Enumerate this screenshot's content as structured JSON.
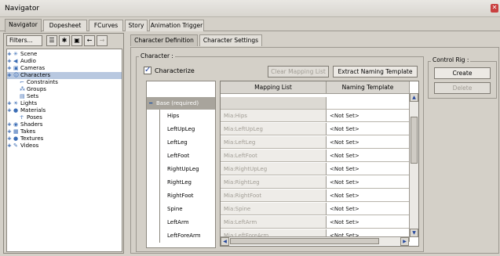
{
  "window": {
    "title": "Navigator"
  },
  "tabs": [
    {
      "label": "Navigator"
    },
    {
      "label": "Dopesheet"
    },
    {
      "label": "FCurves"
    },
    {
      "label": "Story"
    },
    {
      "label": "Animation Trigger"
    }
  ],
  "left_toolbar": {
    "filters_label": "Filters..."
  },
  "tree": [
    {
      "label": "Scene",
      "expand": "+",
      "icon": "scene-icon"
    },
    {
      "label": "Audio",
      "expand": "+",
      "icon": "audio-icon"
    },
    {
      "label": "Cameras",
      "expand": "+",
      "icon": "camera-icon"
    },
    {
      "label": "Characters",
      "expand": "+",
      "icon": "character-icon"
    },
    {
      "label": "Constraints",
      "expand": "",
      "icon": "constraint-icon"
    },
    {
      "label": "Groups",
      "expand": "",
      "icon": "groups-icon"
    },
    {
      "label": "Sets",
      "expand": "",
      "icon": "sets-icon"
    },
    {
      "label": "Lights",
      "expand": "+",
      "icon": "light-icon"
    },
    {
      "label": "Materials",
      "expand": "+",
      "icon": "material-icon"
    },
    {
      "label": "Poses",
      "expand": "",
      "icon": "pose-icon"
    },
    {
      "label": "Shaders",
      "expand": "+",
      "icon": "shader-icon"
    },
    {
      "label": "Takes",
      "expand": "+",
      "icon": "takes-icon"
    },
    {
      "label": "Textures",
      "expand": "+",
      "icon": "texture-icon"
    },
    {
      "label": "Videos",
      "expand": "+",
      "icon": "video-icon"
    }
  ],
  "subtabs": [
    {
      "label": "Character Definition"
    },
    {
      "label": "Character Settings"
    }
  ],
  "character_group": {
    "label": "Character :",
    "characterize_label": "Characterize",
    "characterize_checked": "✓",
    "clear_mapping_label": "Clear Mapping List",
    "extract_label": "Extract Naming Template"
  },
  "control_rig": {
    "label": "Control Rig :",
    "create_label": "Create",
    "delete_label": "Delete"
  },
  "grid": {
    "headers": {
      "mapping": "Mapping List",
      "template": "Naming Template"
    },
    "group_label": "Base (required)",
    "rows": [
      {
        "bone": "Hips",
        "mapping": "Mia:Hips",
        "template": "<Not Set>"
      },
      {
        "bone": "LeftUpLeg",
        "mapping": "Mia:LeftUpLeg",
        "template": "<Not Set>"
      },
      {
        "bone": "LeftLeg",
        "mapping": "Mia:LeftLeg",
        "template": "<Not Set>"
      },
      {
        "bone": "LeftFoot",
        "mapping": "Mia:LeftFoot",
        "template": "<Not Set>"
      },
      {
        "bone": "RightUpLeg",
        "mapping": "Mia:RightUpLeg",
        "template": "<Not Set>"
      },
      {
        "bone": "RightLeg",
        "mapping": "Mia:RightLeg",
        "template": "<Not Set>"
      },
      {
        "bone": "RightFoot",
        "mapping": "Mia:RightFoot",
        "template": "<Not Set>"
      },
      {
        "bone": "Spine",
        "mapping": "Mia:Spine",
        "template": "<Not Set>"
      },
      {
        "bone": "LeftArm",
        "mapping": "Mia:LeftArm",
        "template": "<Not Set>"
      },
      {
        "bone": "LeftForeArm",
        "mapping": "Mia:LeftForeArm",
        "template": "<Not Set>"
      }
    ]
  },
  "colors": {
    "selection": "#b8c8e0",
    "accent": "#1f3f9e"
  }
}
